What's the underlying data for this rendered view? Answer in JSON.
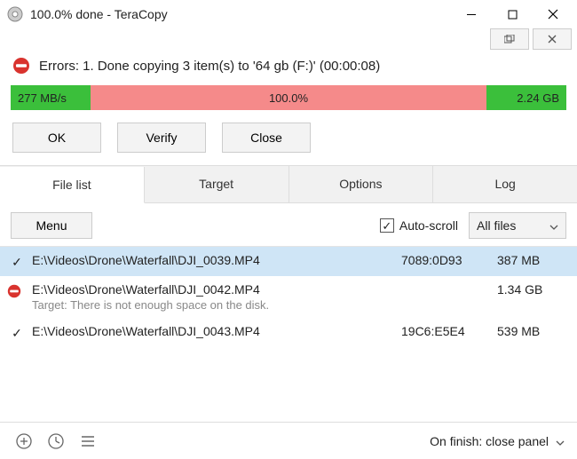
{
  "window": {
    "title": "100.0% done - TeraCopy"
  },
  "status": {
    "text": "Errors: 1. Done copying 3 item(s) to '64 gb (F:)' (00:00:08)"
  },
  "progress": {
    "speed": "277 MB/s",
    "percent": "100.0%",
    "total_size": "2.24 GB"
  },
  "actions": {
    "ok": "OK",
    "verify": "Verify",
    "close": "Close"
  },
  "tabs": {
    "filelist": "File list",
    "target": "Target",
    "options": "Options",
    "log": "Log"
  },
  "listbar": {
    "menu": "Menu",
    "autoscroll_label": "Auto-scroll",
    "autoscroll_checked": true,
    "filter_label": "All files"
  },
  "files": [
    {
      "status": "ok",
      "path": "E:\\Videos\\Drone\\Waterfall\\DJI_0039.MP4",
      "hash": "7089:0D93",
      "size": "387 MB",
      "selected": true
    },
    {
      "status": "error",
      "path": "E:\\Videos\\Drone\\Waterfall\\DJI_0042.MP4",
      "error_msg": "Target: There is not enough space on the disk.",
      "hash": "",
      "size": "1.34 GB",
      "selected": false
    },
    {
      "status": "ok",
      "path": "E:\\Videos\\Drone\\Waterfall\\DJI_0043.MP4",
      "hash": "19C6:E5E4",
      "size": "539 MB",
      "selected": false
    }
  ],
  "bottom": {
    "on_finish": "On finish: close panel"
  }
}
